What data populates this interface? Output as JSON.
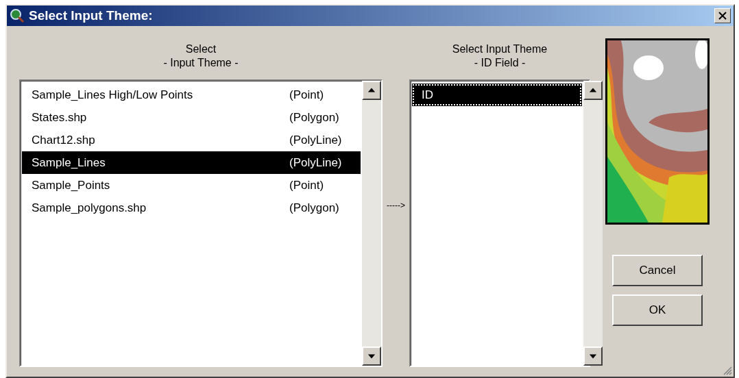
{
  "window": {
    "title": "Select Input Theme:"
  },
  "theme_list": {
    "header": [
      "Select",
      "- Input Theme -"
    ],
    "rows": [
      {
        "name": "Sample_Lines High/Low Points",
        "type": "(Point)",
        "selected": false
      },
      {
        "name": "States.shp",
        "type": "(Polygon)",
        "selected": false
      },
      {
        "name": "Chart12.shp",
        "type": "(PolyLine)",
        "selected": false
      },
      {
        "name": "Sample_Lines",
        "type": "(PolyLine)",
        "selected": true
      },
      {
        "name": "Sample_Points",
        "type": "(Point)",
        "selected": false
      },
      {
        "name": "Sample_polygons.shp",
        "type": "(Polygon)",
        "selected": false
      }
    ]
  },
  "arrow": "----->",
  "field_list": {
    "header": [
      "Select Input Theme",
      "- ID Field -"
    ],
    "rows": [
      {
        "name": "ID",
        "selected": true,
        "focused": true
      }
    ]
  },
  "buttons": [
    "Cancel",
    "OK"
  ]
}
